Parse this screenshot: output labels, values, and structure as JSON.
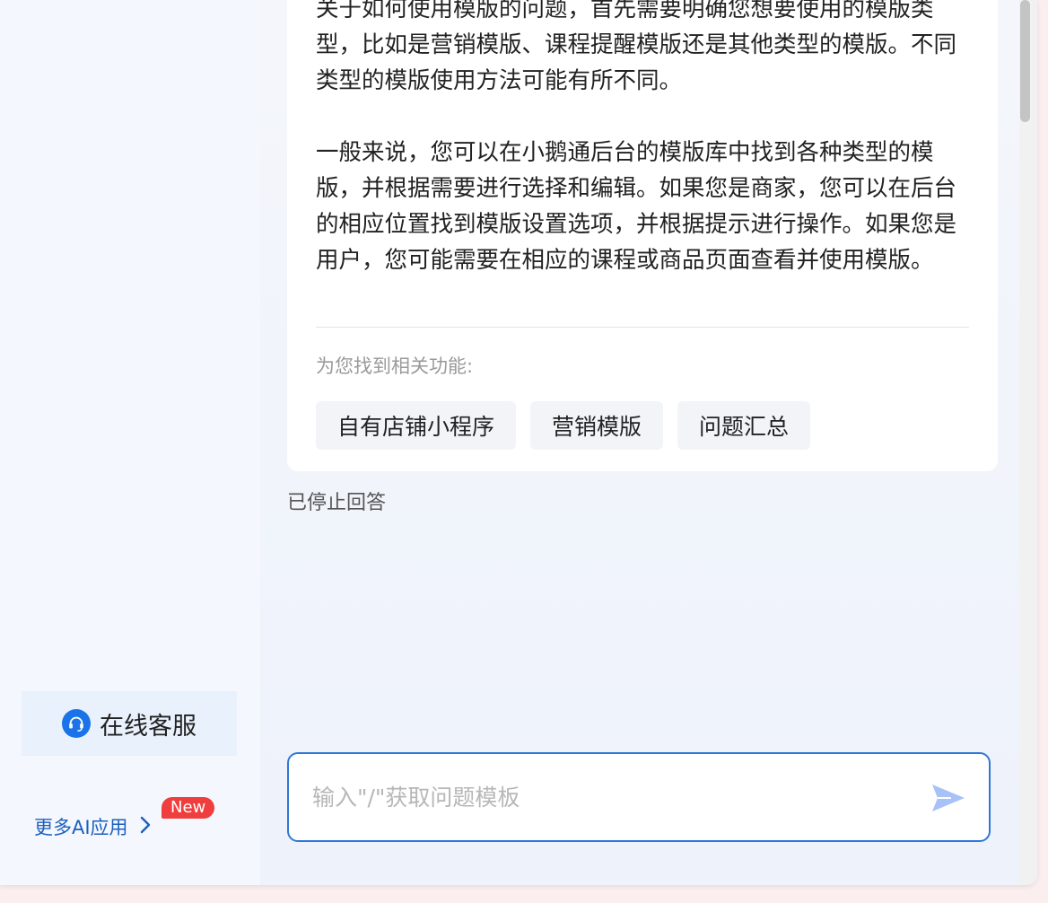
{
  "sidebar": {
    "service_label": "在线客服",
    "more_ai_label": "更多AI应用",
    "new_badge": "New"
  },
  "answer": {
    "paragraph_1": "关于如何使用模版的问题，首先需要明确您想要使用的模版类型，比如是营销模版、课程提醒模版还是其他类型的模版。不同类型的模版使用方法可能有所不同。",
    "paragraph_2": "一般来说，您可以在小鹅通后台的模版库中找到各种类型的模版，并根据需要进行选择和编辑。如果您是商家，您可以在后台的相应位置找到模版设置选项，并根据提示进行操作。如果您是用户，您可能需要在相应的课程或商品页面查看并使用模版。",
    "related_label": "为您找到相关功能:",
    "chips": [
      "自有店铺小程序",
      "营销模版",
      "问题汇总"
    ]
  },
  "status": {
    "stopped": "已停止回答"
  },
  "input": {
    "placeholder": "输入\"/\"获取问题模板",
    "value": ""
  },
  "colors": {
    "accent": "#2f78d6",
    "badge": "#f03d3d",
    "send_icon": "#a8c2f7"
  },
  "icons": {
    "service": "headset-icon",
    "more_ai": "chevron-right-icon",
    "send": "send-icon"
  }
}
